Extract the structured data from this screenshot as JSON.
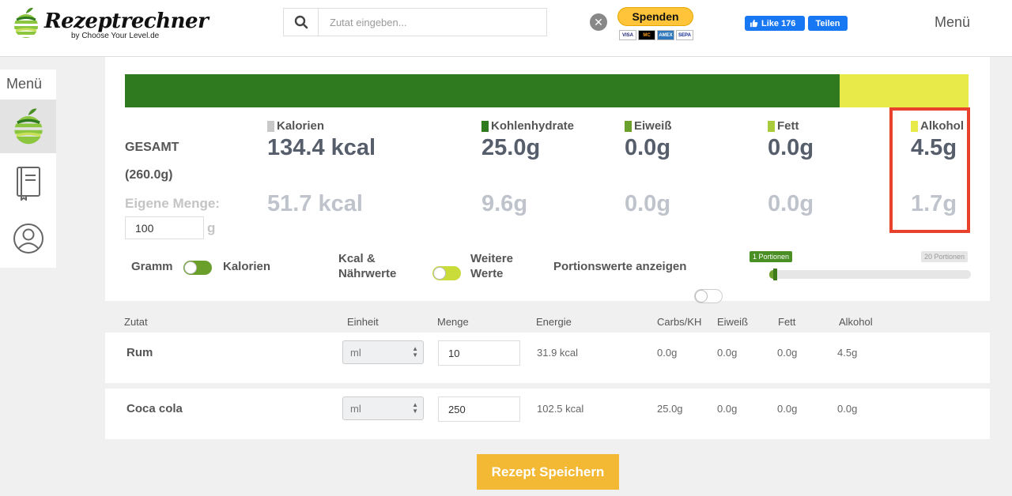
{
  "header": {
    "logo_text": "Rezeptrechner",
    "logo_sub": "by Choose Your Level.de",
    "search_placeholder": "Zutat eingeben...",
    "spenden_label": "Spenden",
    "payment_cards": [
      "VISA",
      "MC",
      "AMEX",
      "SEPA"
    ],
    "fb_like_label": "Like 176",
    "fb_share_label": "Teilen",
    "menu_label": "Menü"
  },
  "sidebar": {
    "menu_label": "Menü",
    "items": [
      {
        "icon": "apple-icon",
        "active": true
      },
      {
        "icon": "book-icon",
        "active": false
      },
      {
        "icon": "user-icon",
        "active": false
      }
    ]
  },
  "summary": {
    "bar_segments": [
      {
        "name": "Kohlenhydrate",
        "fraction": 0.847,
        "color": "#2f7a1f"
      },
      {
        "name": "Alkohol",
        "fraction": 0.153,
        "color": "#e8ea4a"
      }
    ],
    "gesamt_label": "GESAMT",
    "gesamt_weight": "(260.0g)",
    "eigene_label": "Eigene Menge:",
    "eigene_value": "100",
    "eigene_unit": "g",
    "columns": [
      {
        "label": "Kalorien",
        "color": "#c8c8c8",
        "total": "134.4 kcal",
        "own": "51.7 kcal"
      },
      {
        "label": "Kohlenhydrate",
        "color": "#2f7a1f",
        "total": "25.0g",
        "own": "9.6g"
      },
      {
        "label": "Eiweiß",
        "color": "#6a9f2b",
        "total": "0.0g",
        "own": "0.0g"
      },
      {
        "label": "Fett",
        "color": "#a9cc3c",
        "total": "0.0g",
        "own": "0.0g"
      },
      {
        "label": "Alkohol",
        "color": "#e8ea4a",
        "total": "4.5g",
        "own": "1.7g"
      }
    ],
    "toggles": {
      "gramm": "Gramm",
      "kalorien": "Kalorien",
      "kcal_line1": "Kcal &",
      "kcal_line2": "Nährwerte",
      "weitere_line1": "Weitere",
      "weitere_line2": "Werte",
      "portion_label": "Portionswerte anzeigen"
    },
    "portions": {
      "min_label": "1 Portionen",
      "max_label": "20 Portionen",
      "value_fraction": 0.02
    }
  },
  "table": {
    "headers": [
      "Zutat",
      "Einheit",
      "Menge",
      "Energie",
      "Carbs/KH",
      "Eiweiß",
      "Fett",
      "Alkohol"
    ],
    "rows": [
      {
        "name": "Rum",
        "unit": "ml",
        "qty": "10",
        "energie": "31.9 kcal",
        "carbs": "0.0g",
        "eiweiss": "0.0g",
        "fett": "0.0g",
        "alkohol": "4.5g"
      },
      {
        "name": "Coca cola",
        "unit": "ml",
        "qty": "250",
        "energie": "102.5 kcal",
        "carbs": "25.0g",
        "eiweiss": "0.0g",
        "fett": "0.0g",
        "alkohol": "0.0g"
      }
    ]
  },
  "save_label": "Rezept Speichern",
  "colors": {
    "green_dark": "#2f7a1f",
    "yellow": "#e8ea4a",
    "highlight_red": "#e8412c",
    "save_orange": "#f3b935"
  }
}
